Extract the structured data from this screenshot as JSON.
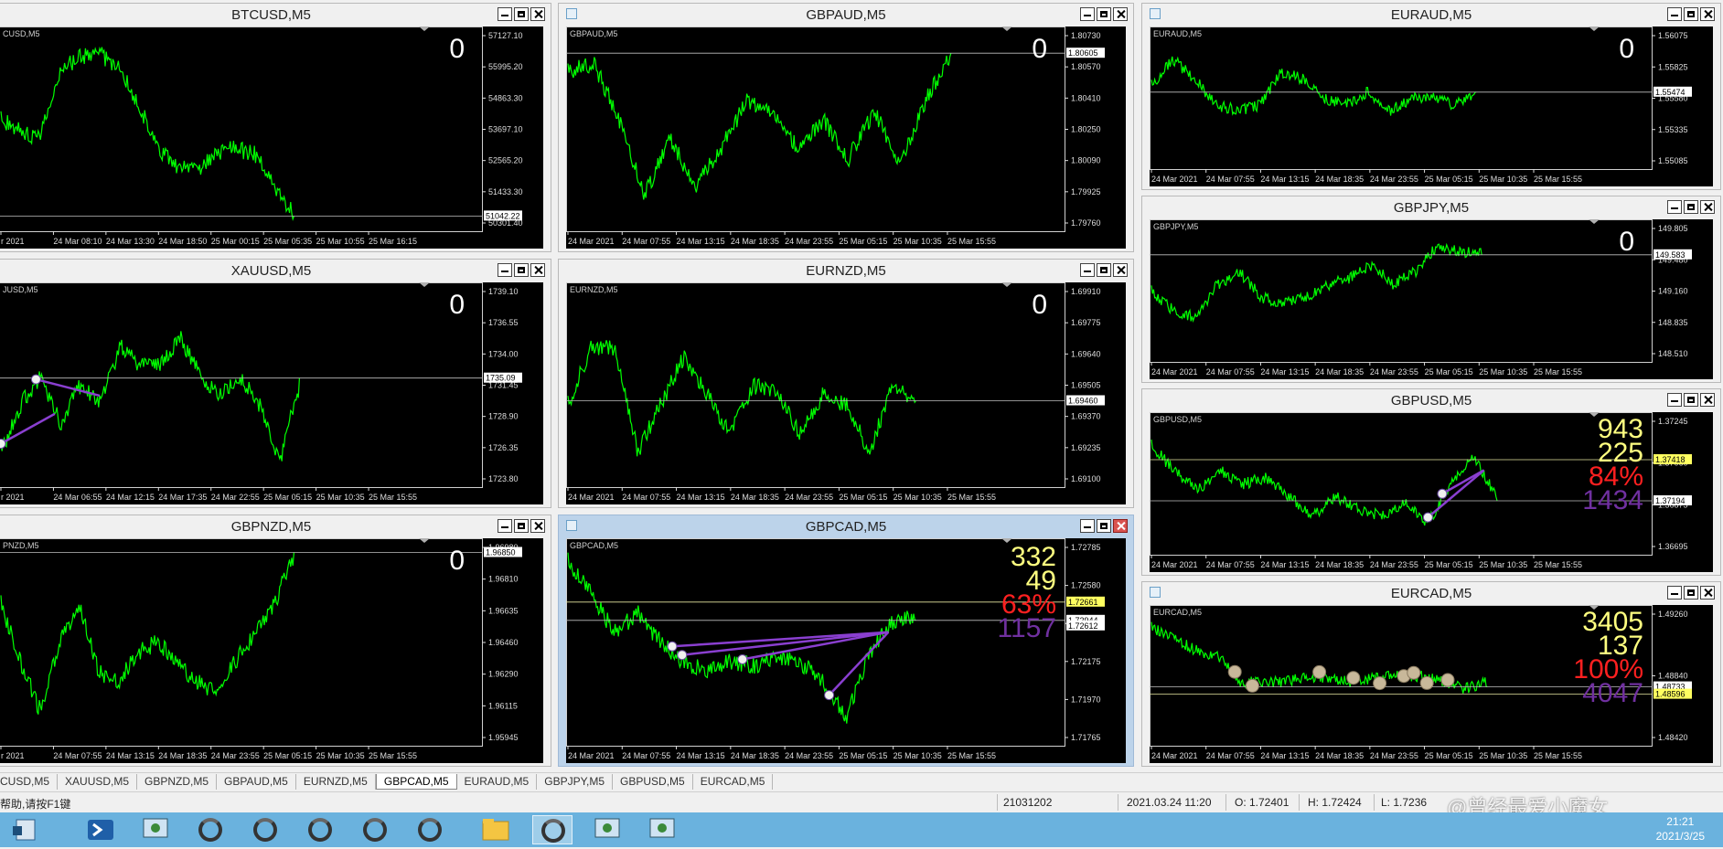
{
  "colors": {
    "price_line": "#00ff00",
    "line_purple": "#8a3fd0",
    "bid_line": "#c0c0c0",
    "yellow": "#ffff80",
    "red": "#ff2020",
    "purple_text": "#7030a0"
  },
  "windows": [
    {
      "id": "btc",
      "title": "BTCUSD,M5",
      "label": "CUSD,M5",
      "counter": "0",
      "prices": [
        "57127.10",
        "55995.20",
        "54863.30",
        "53697.10",
        "52565.20",
        "51433.30",
        "50301.40"
      ],
      "tag": "51042.22",
      "times": [
        "r 2021",
        "24 Mar 08:10",
        "24 Mar 13:30",
        "24 Mar 18:50",
        "25 Mar 00:15",
        "25 Mar 05:35",
        "25 Mar 10:55",
        "25 Mar 16:15"
      ]
    },
    {
      "id": "gbpaud",
      "title": "GBPAUD,M5",
      "label": "GBPAUD,M5",
      "counter": "0",
      "prices": [
        "1.80730",
        "1.80570",
        "1.80410",
        "1.80250",
        "1.80090",
        "1.79925",
        "1.79760"
      ],
      "tag": "1.80605",
      "times": [
        "24 Mar 2021",
        "24 Mar 07:55",
        "24 Mar 13:15",
        "24 Mar 18:35",
        "24 Mar 23:55",
        "25 Mar 05:15",
        "25 Mar 10:35",
        "25 Mar 15:55"
      ]
    },
    {
      "id": "euraud",
      "title": "EURAUD,M5",
      "label": "EURAUD,M5",
      "counter": "0",
      "prices": [
        "1.56075",
        "1.55825",
        "1.55580",
        "1.55335",
        "1.55085"
      ],
      "tag": "1.55474",
      "times": [
        "24 Mar 2021",
        "24 Mar 07:55",
        "24 Mar 13:15",
        "24 Mar 18:35",
        "24 Mar 23:55",
        "25 Mar 05:15",
        "25 Mar 10:35",
        "25 Mar 15:55"
      ]
    },
    {
      "id": "xau",
      "title": "XAUUSD,M5",
      "label": "JUSD,M5",
      "counter": "0",
      "prices": [
        "1739.10",
        "1736.55",
        "1734.00",
        "1731.45",
        "1728.90",
        "1726.35",
        "1723.80"
      ],
      "tag": "1735.09",
      "times": [
        "r 2021",
        "24 Mar 06:55",
        "24 Mar 12:15",
        "24 Mar 17:35",
        "24 Mar 22:55",
        "25 Mar 05:15",
        "25 Mar 10:35",
        "25 Mar 15:55"
      ]
    },
    {
      "id": "eurnzd",
      "title": "EURNZD,M5",
      "label": "EURNZD,M5",
      "counter": "0",
      "prices": [
        "1.69910",
        "1.69775",
        "1.69640",
        "1.69505",
        "1.69370",
        "1.69235",
        "1.69100"
      ],
      "tag": "1.69460",
      "times": [
        "24 Mar 2021",
        "24 Mar 07:55",
        "24 Mar 13:15",
        "24 Mar 18:35",
        "24 Mar 23:55",
        "25 Mar 05:15",
        "25 Mar 10:35",
        "25 Mar 15:55"
      ]
    },
    {
      "id": "gbpjpy",
      "title": "GBPJPY,M5",
      "label": "GBPJPY,M5",
      "counter": "0",
      "prices": [
        "149.805",
        "149.480",
        "149.160",
        "148.835",
        "148.510"
      ],
      "tag": "149.583",
      "times": [
        "24 Mar 2021",
        "24 Mar 07:55",
        "24 Mar 13:15",
        "24 Mar 18:35",
        "24 Mar 23:55",
        "25 Mar 05:15",
        "25 Mar 10:35",
        "25 Mar 15:55"
      ]
    },
    {
      "id": "gbpusd",
      "title": "GBPUSD,M5",
      "label": "GBPUSD,M5",
      "stats": [
        "943",
        "225",
        "84%",
        "1434"
      ],
      "prices": [
        "1.37245",
        "1.37060",
        "1.36875",
        "1.36695"
      ],
      "tag": "1.37194",
      "tag2": "1.37418",
      "times": [
        "24 Mar 2021",
        "24 Mar 07:55",
        "24 Mar 13:15",
        "24 Mar 18:35",
        "24 Mar 23:55",
        "25 Mar 05:15",
        "25 Mar 10:35",
        "25 Mar 15:55"
      ]
    },
    {
      "id": "gbpnzd",
      "title": "GBPNZD,M5",
      "label": "PNZD,M5",
      "counter": "0",
      "prices": [
        "1.96980",
        "1.96810",
        "1.96635",
        "1.96460",
        "1.96290",
        "1.96115",
        "1.95945"
      ],
      "tag": "1.96850",
      "times": [
        "r 2021",
        "24 Mar 07:55",
        "24 Mar 13:15",
        "24 Mar 18:35",
        "24 Mar 23:55",
        "25 Mar 05:15",
        "25 Mar 10:35",
        "25 Mar 15:55"
      ]
    },
    {
      "id": "gbpcad",
      "title": "GBPCAD,M5",
      "label": "GBPCAD,M5",
      "stats": [
        "332",
        "49",
        "63%",
        "1157"
      ],
      "prices": [
        "1.72785",
        "1.72580",
        "1.72375",
        "1.72175",
        "1.71970",
        "1.71765"
      ],
      "tag": "1.72944",
      "tag2": "1.72661",
      "tag3": "1.72612",
      "times": [
        "24 Mar 2021",
        "24 Mar 07:55",
        "24 Mar 13:15",
        "24 Mar 18:35",
        "24 Mar 23:55",
        "25 Mar 05:15",
        "25 Mar 10:35",
        "25 Mar 15:55"
      ]
    },
    {
      "id": "eurcad",
      "title": "EURCAD,M5",
      "label": "EURCAD,M5",
      "stats": [
        "3405",
        "137",
        "100%",
        "4047"
      ],
      "prices": [
        "1.49260",
        "1.48840",
        "1.48420"
      ],
      "tag": "1.48733",
      "tag2": "1.48596",
      "times": [
        "24 Mar 2021",
        "24 Mar 07:55",
        "24 Mar 13:15",
        "24 Mar 18:35",
        "24 Mar 23:55",
        "25 Mar 05:15",
        "25 Mar 10:35",
        "25 Mar 15:55"
      ]
    }
  ],
  "tabs": [
    "CUSD,M5",
    "XAUUSD,M5",
    "GBPNZD,M5",
    "GBPAUD,M5",
    "EURNZD,M5",
    "GBPCAD,M5",
    "EURAUD,M5",
    "GBPJPY,M5",
    "GBPUSD,M5",
    "EURCAD,M5"
  ],
  "active_tab": "GBPCAD,M5",
  "status": {
    "help": "帮助,请按F1键",
    "profile": "21031202",
    "datetime": "2021.03.24 11:20",
    "open": "O: 1.72401",
    "high": "H: 1.72424",
    "low": "L: 1.7236"
  },
  "watermark": "@曾经最爱小魔女",
  "clock": {
    "time": "21:21",
    "date": "2021/3/25"
  }
}
